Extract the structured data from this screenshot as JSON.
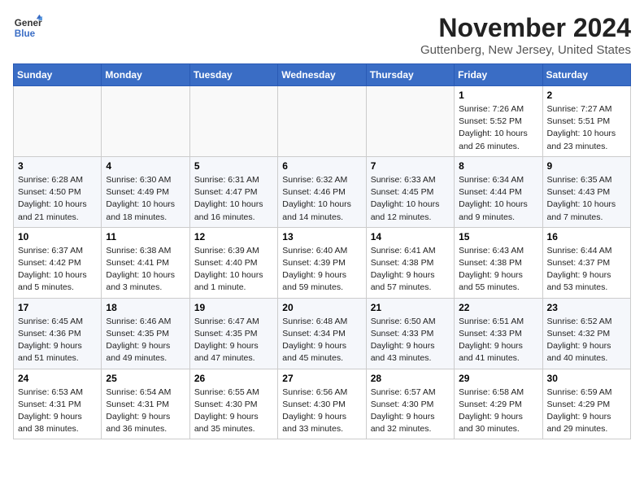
{
  "header": {
    "logo_line1": "General",
    "logo_line2": "Blue",
    "month_title": "November 2024",
    "location": "Guttenberg, New Jersey, United States"
  },
  "weekdays": [
    "Sunday",
    "Monday",
    "Tuesday",
    "Wednesday",
    "Thursday",
    "Friday",
    "Saturday"
  ],
  "weeks": [
    [
      {
        "day": "",
        "info": ""
      },
      {
        "day": "",
        "info": ""
      },
      {
        "day": "",
        "info": ""
      },
      {
        "day": "",
        "info": ""
      },
      {
        "day": "",
        "info": ""
      },
      {
        "day": "1",
        "info": "Sunrise: 7:26 AM\nSunset: 5:52 PM\nDaylight: 10 hours and 26 minutes."
      },
      {
        "day": "2",
        "info": "Sunrise: 7:27 AM\nSunset: 5:51 PM\nDaylight: 10 hours and 23 minutes."
      }
    ],
    [
      {
        "day": "3",
        "info": "Sunrise: 6:28 AM\nSunset: 4:50 PM\nDaylight: 10 hours and 21 minutes."
      },
      {
        "day": "4",
        "info": "Sunrise: 6:30 AM\nSunset: 4:49 PM\nDaylight: 10 hours and 18 minutes."
      },
      {
        "day": "5",
        "info": "Sunrise: 6:31 AM\nSunset: 4:47 PM\nDaylight: 10 hours and 16 minutes."
      },
      {
        "day": "6",
        "info": "Sunrise: 6:32 AM\nSunset: 4:46 PM\nDaylight: 10 hours and 14 minutes."
      },
      {
        "day": "7",
        "info": "Sunrise: 6:33 AM\nSunset: 4:45 PM\nDaylight: 10 hours and 12 minutes."
      },
      {
        "day": "8",
        "info": "Sunrise: 6:34 AM\nSunset: 4:44 PM\nDaylight: 10 hours and 9 minutes."
      },
      {
        "day": "9",
        "info": "Sunrise: 6:35 AM\nSunset: 4:43 PM\nDaylight: 10 hours and 7 minutes."
      }
    ],
    [
      {
        "day": "10",
        "info": "Sunrise: 6:37 AM\nSunset: 4:42 PM\nDaylight: 10 hours and 5 minutes."
      },
      {
        "day": "11",
        "info": "Sunrise: 6:38 AM\nSunset: 4:41 PM\nDaylight: 10 hours and 3 minutes."
      },
      {
        "day": "12",
        "info": "Sunrise: 6:39 AM\nSunset: 4:40 PM\nDaylight: 10 hours and 1 minute."
      },
      {
        "day": "13",
        "info": "Sunrise: 6:40 AM\nSunset: 4:39 PM\nDaylight: 9 hours and 59 minutes."
      },
      {
        "day": "14",
        "info": "Sunrise: 6:41 AM\nSunset: 4:38 PM\nDaylight: 9 hours and 57 minutes."
      },
      {
        "day": "15",
        "info": "Sunrise: 6:43 AM\nSunset: 4:38 PM\nDaylight: 9 hours and 55 minutes."
      },
      {
        "day": "16",
        "info": "Sunrise: 6:44 AM\nSunset: 4:37 PM\nDaylight: 9 hours and 53 minutes."
      }
    ],
    [
      {
        "day": "17",
        "info": "Sunrise: 6:45 AM\nSunset: 4:36 PM\nDaylight: 9 hours and 51 minutes."
      },
      {
        "day": "18",
        "info": "Sunrise: 6:46 AM\nSunset: 4:35 PM\nDaylight: 9 hours and 49 minutes."
      },
      {
        "day": "19",
        "info": "Sunrise: 6:47 AM\nSunset: 4:35 PM\nDaylight: 9 hours and 47 minutes."
      },
      {
        "day": "20",
        "info": "Sunrise: 6:48 AM\nSunset: 4:34 PM\nDaylight: 9 hours and 45 minutes."
      },
      {
        "day": "21",
        "info": "Sunrise: 6:50 AM\nSunset: 4:33 PM\nDaylight: 9 hours and 43 minutes."
      },
      {
        "day": "22",
        "info": "Sunrise: 6:51 AM\nSunset: 4:33 PM\nDaylight: 9 hours and 41 minutes."
      },
      {
        "day": "23",
        "info": "Sunrise: 6:52 AM\nSunset: 4:32 PM\nDaylight: 9 hours and 40 minutes."
      }
    ],
    [
      {
        "day": "24",
        "info": "Sunrise: 6:53 AM\nSunset: 4:31 PM\nDaylight: 9 hours and 38 minutes."
      },
      {
        "day": "25",
        "info": "Sunrise: 6:54 AM\nSunset: 4:31 PM\nDaylight: 9 hours and 36 minutes."
      },
      {
        "day": "26",
        "info": "Sunrise: 6:55 AM\nSunset: 4:30 PM\nDaylight: 9 hours and 35 minutes."
      },
      {
        "day": "27",
        "info": "Sunrise: 6:56 AM\nSunset: 4:30 PM\nDaylight: 9 hours and 33 minutes."
      },
      {
        "day": "28",
        "info": "Sunrise: 6:57 AM\nSunset: 4:30 PM\nDaylight: 9 hours and 32 minutes."
      },
      {
        "day": "29",
        "info": "Sunrise: 6:58 AM\nSunset: 4:29 PM\nDaylight: 9 hours and 30 minutes."
      },
      {
        "day": "30",
        "info": "Sunrise: 6:59 AM\nSunset: 4:29 PM\nDaylight: 9 hours and 29 minutes."
      }
    ]
  ]
}
